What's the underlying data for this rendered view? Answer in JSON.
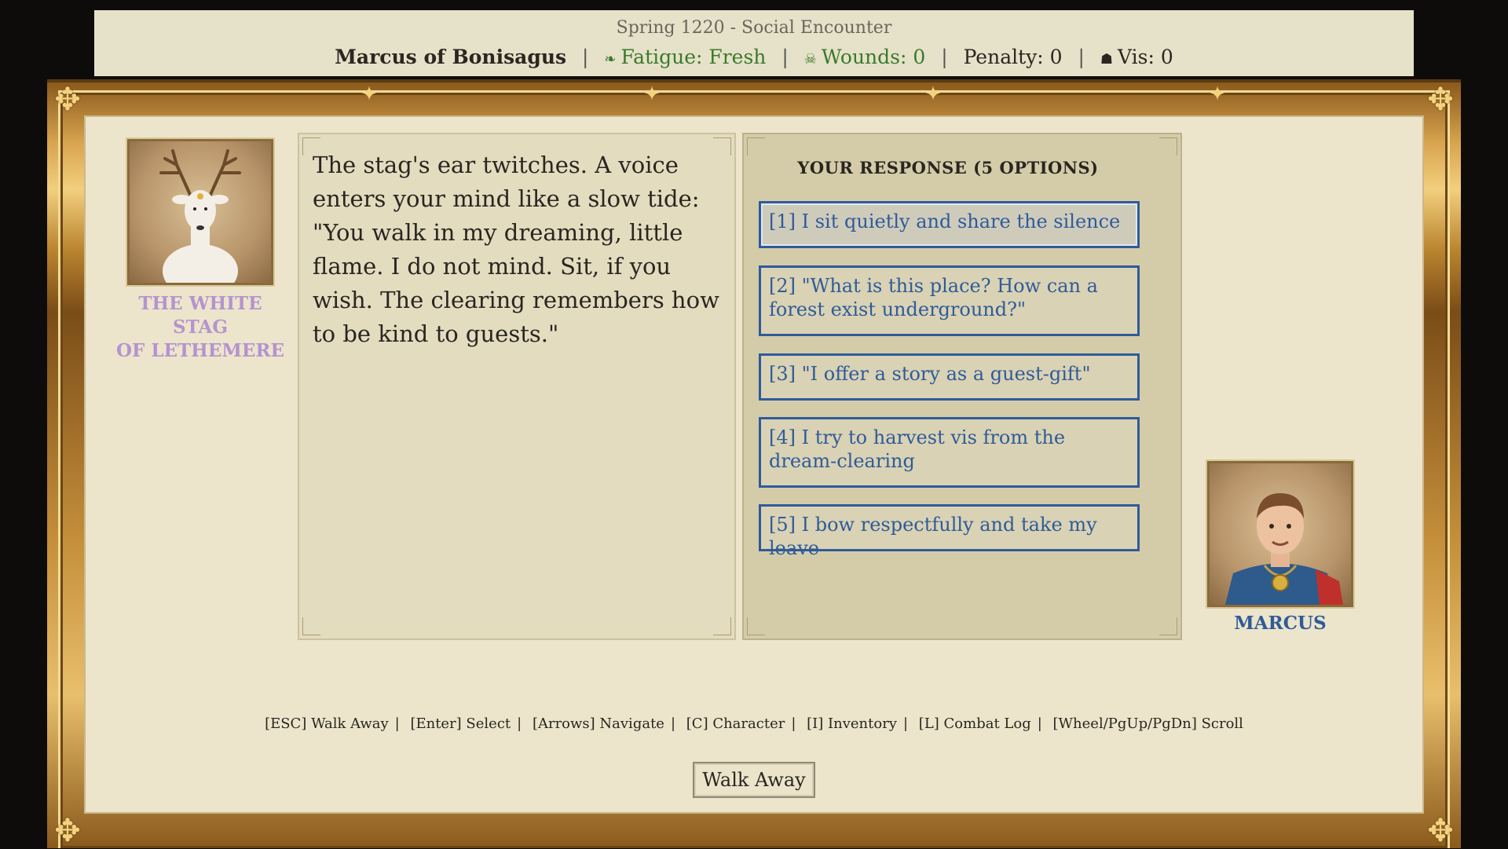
{
  "status": {
    "season": "Spring 1220 - Social Encounter",
    "character": "Marcus of Bonisagus",
    "fatigue": "Fatigue: Fresh",
    "wounds": "Wounds: 0",
    "penalty": "Penalty: 0",
    "vis": "Vis: 0",
    "icons": {
      "fatigue": "leaf-icon",
      "wounds": "skull-icon",
      "vis": "vis-icon"
    }
  },
  "npc": {
    "name_lines": [
      "THE WHITE",
      "STAG",
      "OF LETHEMERE"
    ],
    "portrait": "white-stag-portrait"
  },
  "dialogue": {
    "text": "The stag's ear twitches. A voice enters your mind like a slow tide: \"You walk in my dreaming, little flame. I do not mind. Sit, if you wish. The clearing remembers how to be kind to guests.\""
  },
  "responses": {
    "header": "YOUR RESPONSE (5 OPTIONS)",
    "selected_index": 0,
    "options": [
      "[1] I sit quietly and share the silence",
      "[2] \"What is this place? How can a forest exist underground?\"",
      "[3] \"I offer a story as a guest-gift\"",
      "[4] I try to harvest vis from the dream-clearing",
      "[5] I bow respectfully and take my leave"
    ]
  },
  "player": {
    "name": "MARCUS",
    "portrait": "marcus-portrait"
  },
  "hints": [
    "[ESC] Walk Away",
    "[Enter] Select",
    "[Arrows] Navigate",
    "[C] Character",
    "[I] Inventory",
    "[L] Combat Log",
    "[Wheel/PgUp/PgDn] Scroll"
  ],
  "walk_away_label": "Walk Away",
  "colors": {
    "accent_blue": "#2f5b99",
    "npc_name": "#b593cf",
    "status_green": "#3a7a2a",
    "parchment": "#ece5cb",
    "gold": "#d9a550"
  }
}
